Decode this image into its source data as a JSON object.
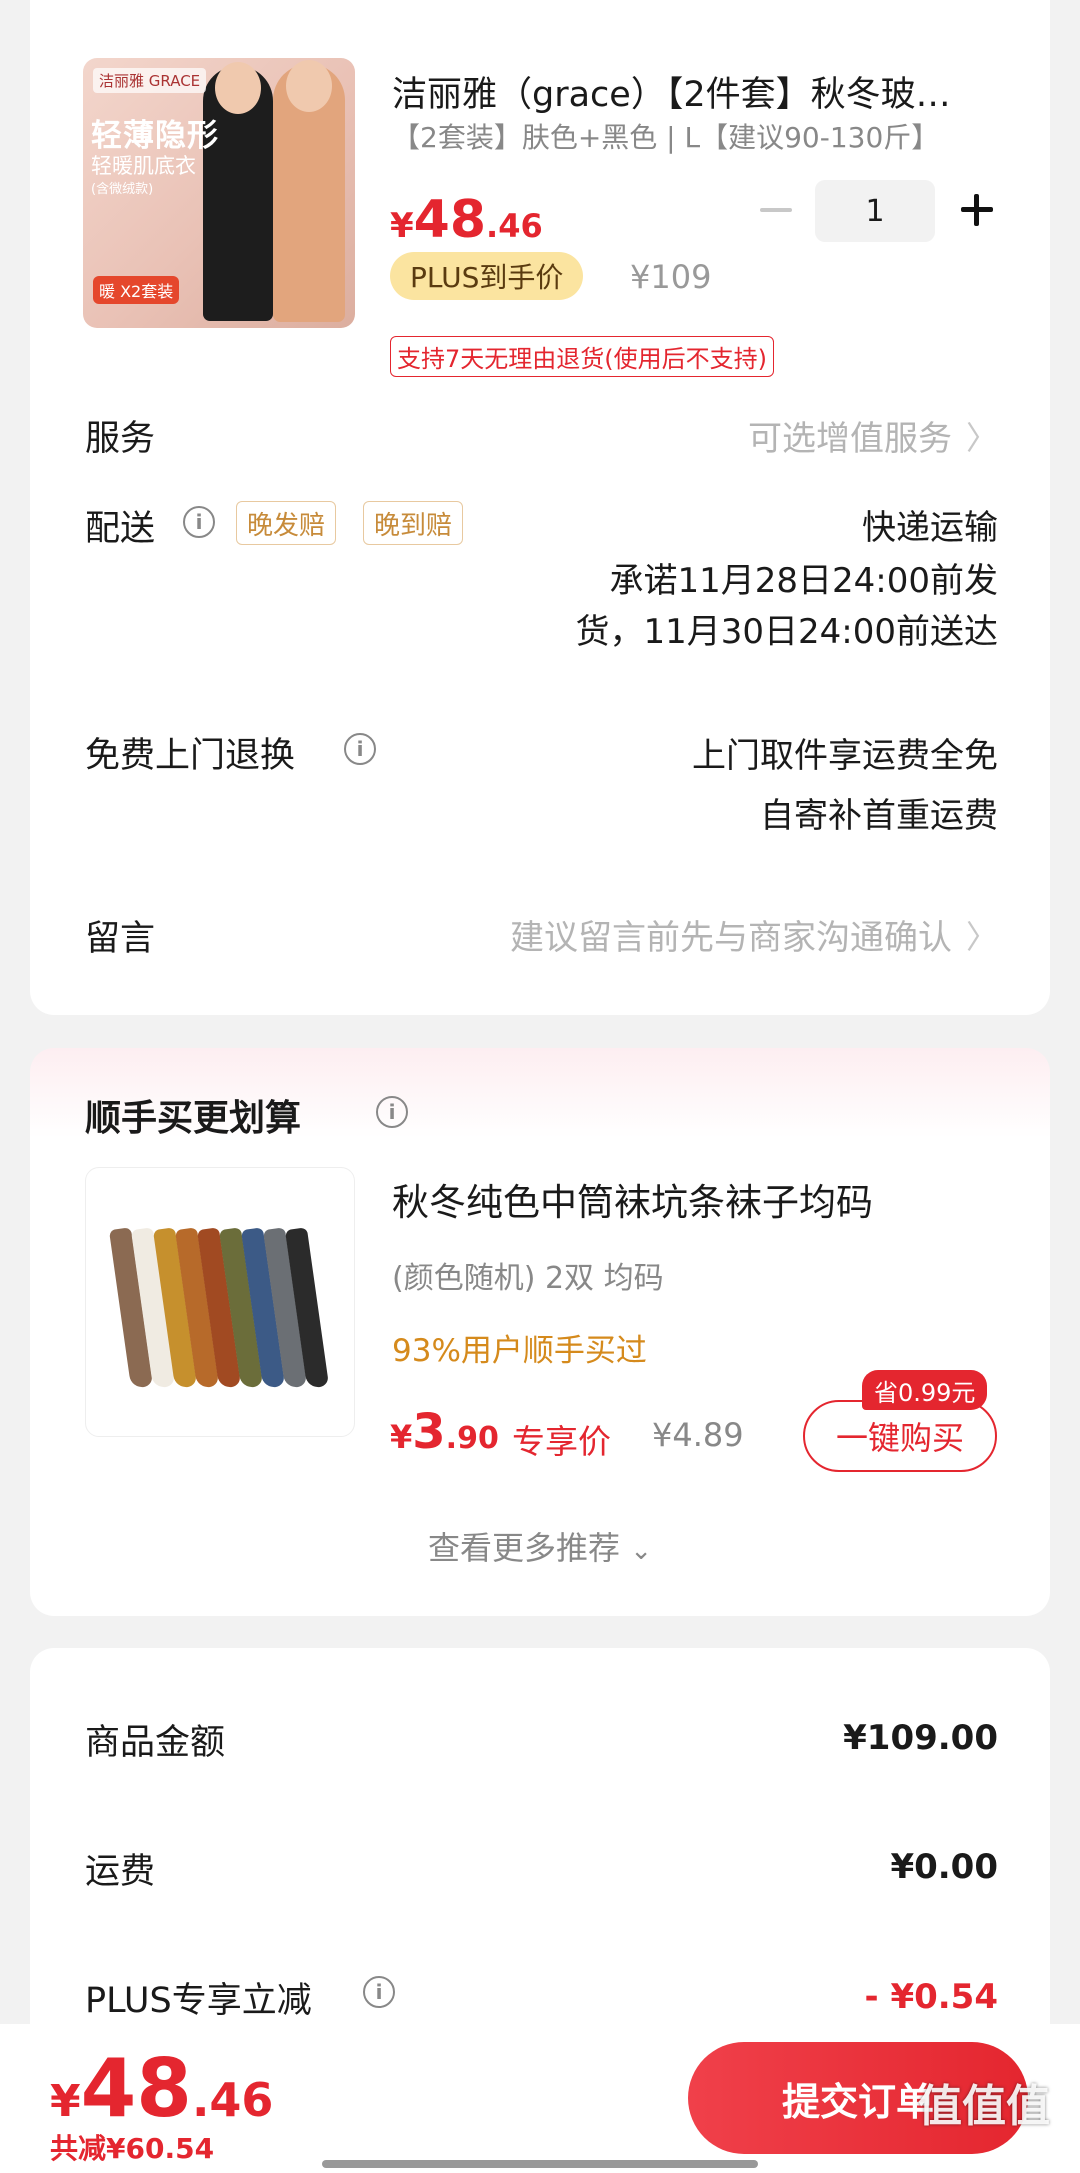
{
  "product": {
    "thumb_logo": "洁丽雅 GRACE",
    "thumb_tag1": "轻薄隐形",
    "thumb_tag2": "轻暖肌底衣",
    "thumb_tag3": "(含微绒款)",
    "thumb_tag4": "暖 X2套装",
    "title": "洁丽雅（grace）【2件套】秋冬玻…",
    "spec": "【2套装】肤色+黑色 | L【建议90-130斤】",
    "price_currency": "¥",
    "price_int": "48",
    "price_dec": ".46",
    "quantity": "1",
    "plus_badge": "PLUS到手价",
    "original_price": "¥109",
    "return_policy": "支持7天无理由退货(使用后不支持)"
  },
  "rows": {
    "service_label": "服务",
    "service_value": "可选增值服务",
    "delivery_label": "配送",
    "delivery_tag1": "晚发赔",
    "delivery_tag2": "晚到赔",
    "delivery_method": "快递运输",
    "delivery_promise_line1": "承诺11月28日24:00前发",
    "delivery_promise_line2": "货，11月30日24:00前送达",
    "return_label": "免费上门退换",
    "return_line1": "上门取件享运费全免",
    "return_line2": "自寄补首重运费",
    "message_label": "留言",
    "message_placeholder": "建议留言前先与商家沟通确认"
  },
  "recommend": {
    "title": "顺手买更划算",
    "name": "秋冬纯色中筒袜坑条袜子均码",
    "spec": "(颜色随机) 2双   均码",
    "bought": "93%用户顺手买过",
    "price_currency": "¥",
    "price_int": "3",
    "price_dec": ".90",
    "exclusive": "专享价",
    "original_price": "¥4.89",
    "save_badge": "省0.99元",
    "buy_label": "一键购买",
    "more_label": "查看更多推荐"
  },
  "summary": {
    "goods_label": "商品金额",
    "goods_value": "¥109.00",
    "shipping_label": "运费",
    "shipping_value": "¥0.00",
    "plus_label": "PLUS专享立减",
    "plus_value": "- ¥0.54"
  },
  "footer": {
    "total_currency": "¥",
    "total_int": "48",
    "total_dec": ".46",
    "saved": "共减¥60.54",
    "submit_label": "提交订单",
    "watermark": "值值值"
  },
  "colors": {
    "accent_red": "#e4262f",
    "plus_gold": "#fbe4a0",
    "tag_orange": "#d58a1c"
  }
}
